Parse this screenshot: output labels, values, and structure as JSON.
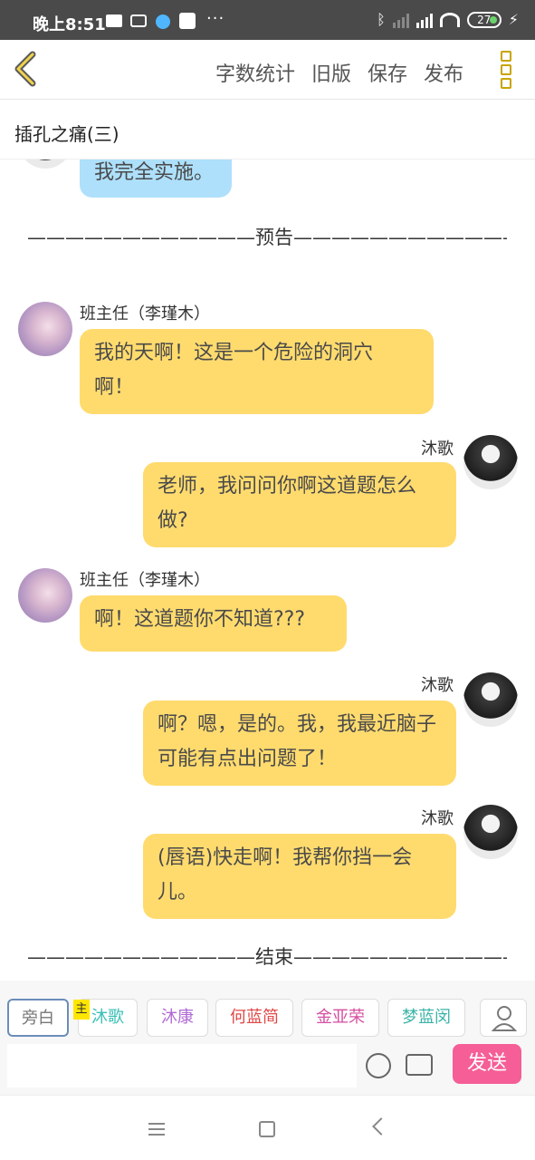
{
  "status": {
    "time": "晚上8:51",
    "dots": "···",
    "battery": "27",
    "bolt": "⚡"
  },
  "toolbar": {
    "actions": [
      "字数统计",
      "旧版",
      "保存",
      "发布"
    ]
  },
  "title": "插孔之痛(三)",
  "chat": {
    "messages": [
      {
        "side": "right",
        "color": "blue",
        "text": "我完全实施。"
      },
      {
        "side": "left",
        "sender": "班主任（李瑾木）",
        "text_lines": [
          "我的天啊！这是一个危险的洞穴",
          "啊！"
        ]
      },
      {
        "side": "right",
        "sender": "沐歌",
        "text_lines": [
          "老师，我问问你啊这道题怎么",
          "做?"
        ]
      },
      {
        "side": "left",
        "sender": "班主任（李瑾木）",
        "text_lines": [
          "啊！这道题你不知道???"
        ]
      },
      {
        "side": "right",
        "sender": "沐歌",
        "text_lines": [
          "啊？嗯，是的。我，我最近脑子",
          "可能有点出问题了！"
        ]
      },
      {
        "side": "right",
        "sender": "沐歌",
        "text_lines": [
          "(唇语)快走啊！我帮你挡一会",
          "儿。"
        ]
      }
    ],
    "divider_preview": "————————————预告————————————",
    "divider_end": "————————————结束—————————————"
  },
  "characters": {
    "host_tag": "主",
    "chips": [
      {
        "label": "旁白",
        "color": "#999999"
      },
      {
        "label": "沐歌",
        "color": "#3bbfb6"
      },
      {
        "label": "沐康",
        "color": "#b06ad4"
      },
      {
        "label": "何蓝简",
        "color": "#e04848"
      },
      {
        "label": "金亚荣",
        "color": "#d64fa0"
      },
      {
        "label": "梦蓝闵",
        "color": "#3bb3a8"
      }
    ]
  },
  "input": {
    "placeholder": "",
    "send_label": "发送"
  },
  "icons": {
    "back": "chevron-left-icon",
    "more": "more-vertical-icon",
    "emoji": "smiley-icon",
    "image": "image-icon",
    "person": "person-icon"
  }
}
